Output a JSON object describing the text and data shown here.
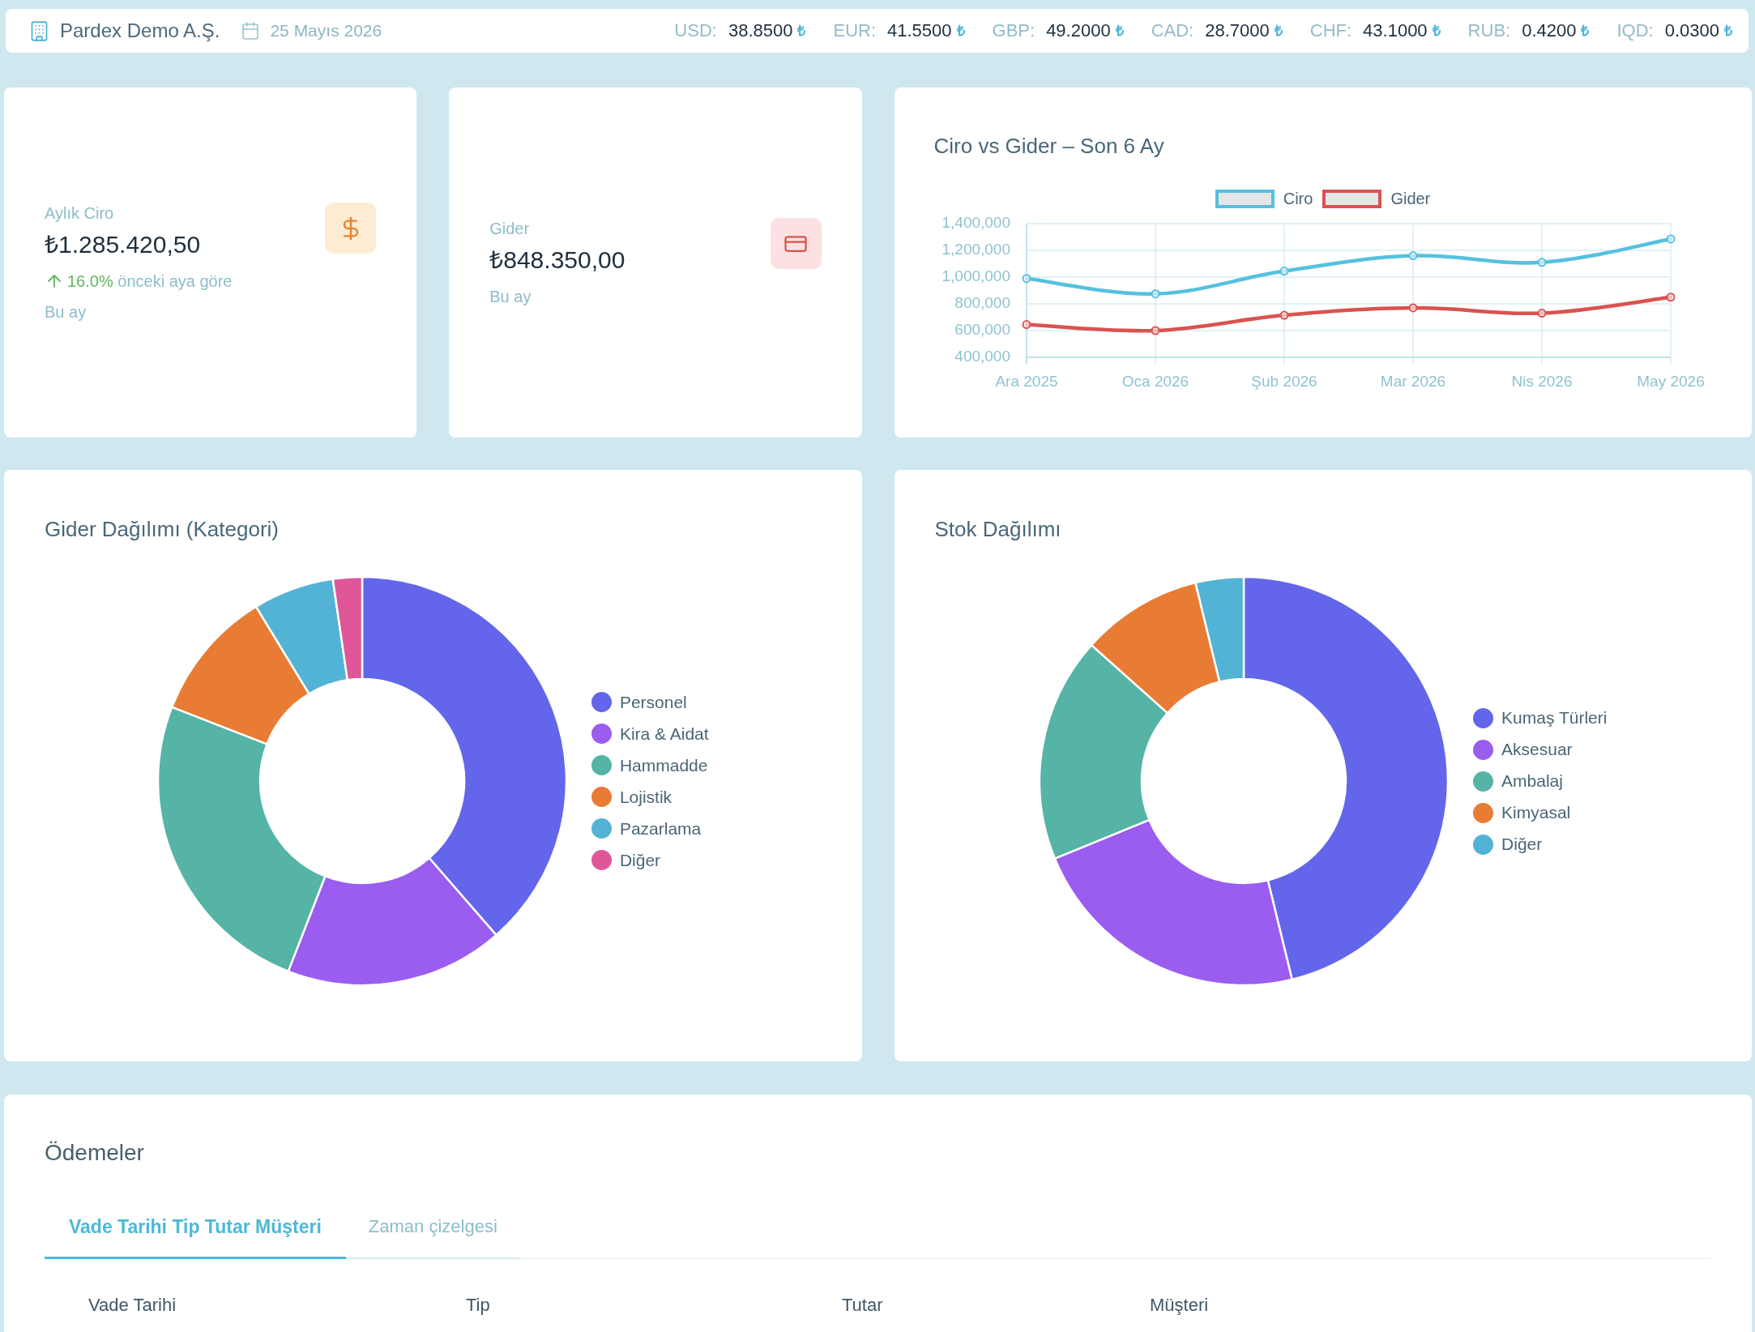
{
  "header": {
    "company": "Pardex Demo A.Ş.",
    "date": "25 Mayıs 2026",
    "rates": [
      {
        "code": "USD:",
        "value": "38.8500",
        "symbol": "₺"
      },
      {
        "code": "EUR:",
        "value": "41.5500",
        "symbol": "₺"
      },
      {
        "code": "GBP:",
        "value": "49.2000",
        "symbol": "₺"
      },
      {
        "code": "CAD:",
        "value": "28.7000",
        "symbol": "₺"
      },
      {
        "code": "CHF:",
        "value": "43.1000",
        "symbol": "₺"
      },
      {
        "code": "RUB:",
        "value": "0.4200",
        "symbol": "₺"
      },
      {
        "code": "IQD:",
        "value": "0.0300",
        "symbol": "₺"
      }
    ]
  },
  "stat_cards": [
    {
      "kind": "income",
      "label": "Aylık Ciro",
      "value": "₺1.285.420,50",
      "change": {
        "value": "16.0%",
        "text": "önceki aya göre"
      },
      "note": "Bu ay"
    },
    {
      "kind": "expense",
      "label": "Gider",
      "value": "₺848.350,00",
      "note": "Bu ay"
    }
  ],
  "trend_chart": {
    "chart_data": {
      "type": "line",
      "title": "Ciro vs Gider – Son 6 Ay",
      "categories": [
        "Ara 2025",
        "Oca 2026",
        "Şub 2026",
        "Mar 2026",
        "Nis 2026",
        "May 2026"
      ],
      "series": [
        {
          "name": "Ciro",
          "color": "#56c0df",
          "marker": "circle",
          "values": [
            990000,
            875000,
            1045000,
            1160000,
            1110000,
            1285000
          ]
        },
        {
          "name": "Gider",
          "color": "#d9534f",
          "marker": "circle",
          "values": [
            645000,
            600000,
            715000,
            770000,
            730000,
            850000
          ]
        }
      ],
      "ylim": [
        400000,
        1400000
      ],
      "yticks": [
        {
          "value": 400000,
          "label": "400,000"
        },
        {
          "value": 600000,
          "label": "600,000"
        },
        {
          "value": 800000,
          "label": "800,000"
        },
        {
          "value": 1000000,
          "label": "1,000,000"
        },
        {
          "value": 1200000,
          "label": "1,200,000"
        },
        {
          "value": 1400000,
          "label": "1,400,000"
        }
      ],
      "grid": true,
      "legend": true
    }
  },
  "expense_chart": {
    "chart_data": {
      "type": "donut",
      "title": "Gider Dağılımı (Kategori)",
      "categories": [
        "Personel",
        "Kira & Aidat",
        "Hammadde",
        "Lojistik",
        "Pazarlama",
        "Diğer"
      ],
      "values": [
        38.6,
        17.3,
        25.0,
        10.4,
        6.4,
        2.3
      ],
      "colors": [
        "#6366ea",
        "#9b5cf0",
        "#55b4a6",
        "#e97c34",
        "#53b3d5",
        "#e05799"
      ],
      "legend": true
    }
  },
  "stock_chart": {
    "chart_data": {
      "type": "donut",
      "title": "Stok Dağılımı",
      "categories": [
        "Kumaş Türleri",
        "Aksesuar",
        "Ambalaj",
        "Kimyasal",
        "Diğer"
      ],
      "values": [
        46.2,
        22.6,
        17.8,
        9.6,
        3.8
      ],
      "colors": [
        "#6366ea",
        "#9b5cf0",
        "#55b4a6",
        "#e97c34",
        "#53b3d5"
      ],
      "legend": true
    }
  },
  "payments": {
    "title": "Ödemeler",
    "tabs": [
      {
        "label": "Vade Tarihi Tip Tutar Müşteri",
        "selected": true
      },
      {
        "label": "Zaman çizelgesi",
        "selected": false
      }
    ],
    "table": {
      "columns": [
        "Vade Tarihi",
        "Tip",
        "Tutar",
        "Müşteri"
      ]
    }
  }
}
